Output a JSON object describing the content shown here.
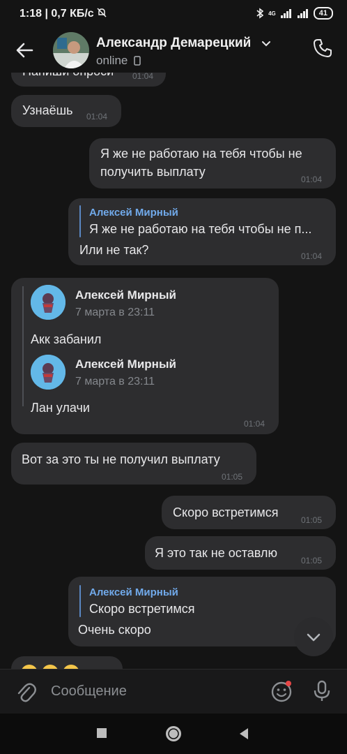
{
  "status_bar": {
    "time": "1:18",
    "speed": "0,7 КБ/с",
    "battery": "41",
    "net": "4G"
  },
  "header": {
    "name": "Александр Демарецкий",
    "status": "online"
  },
  "messages": [
    {
      "text": "Напиши опроси",
      "time": "01:04"
    },
    {
      "text": "Узнаёшь",
      "time": "01:04"
    },
    {
      "text_line1": "Я же не работаю на тебя чтобы не",
      "text_line2": "получить выплату",
      "time": "01:04"
    },
    {
      "reply_name": "Алексей Мирный",
      "reply_text": "Я же не работаю на тебя чтобы не п...",
      "text": "Или не так?",
      "time": "01:04"
    },
    {
      "forwards": [
        {
          "name": "Алексей Мирный",
          "date": "7 марта в 23:11",
          "text": "Акк забанил"
        },
        {
          "name": "Алексей Мирный",
          "date": "7 марта в 23:11",
          "text": "Лан улачи"
        }
      ],
      "time": "01:04"
    },
    {
      "text": "Вот за это ты не получил выплату",
      "time": "01:05"
    },
    {
      "text": "Скоро встретимся",
      "time": "01:05"
    },
    {
      "text": "Я это так не оставлю",
      "time": "01:05"
    },
    {
      "reply_name": "Алексей Мирный",
      "reply_text": "Скоро встретимся",
      "text": "Очень скоро"
    }
  ],
  "composer": {
    "placeholder": "Сообщение"
  },
  "colors": {
    "background": "#141414",
    "bubble": "#2d2d2f",
    "accent": "#71aaeb"
  }
}
